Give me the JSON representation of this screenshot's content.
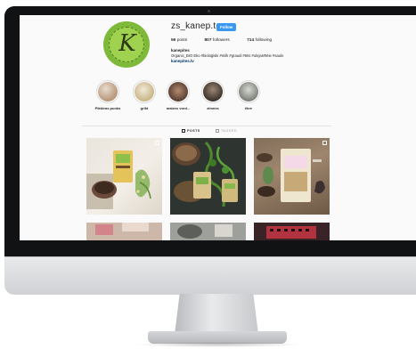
{
  "profile": {
    "username": "zs_kanep.tes",
    "follow_label": "Follow",
    "stats": [
      {
        "value": "56",
        "label": "posts"
      },
      {
        "value": "807",
        "label": "followers"
      },
      {
        "value": "714",
        "label": "following"
      }
    ],
    "display_name": "kanepites",
    "bio": "Organic_BIO Eko #bioloģiski #milk #graudi #tēis #ulejas#tēie #saule",
    "link": "kanepites.lv"
  },
  "highlights": [
    {
      "label": "Piktūras punks",
      "color": "#c9a98a"
    },
    {
      "label": "grīkt",
      "color": "#d7c7a3"
    },
    {
      "label": "maizes vord...",
      "color": "#8a6b5a"
    },
    {
      "label": "zimnes",
      "color": "#6d5a4c"
    },
    {
      "label": "ēkre",
      "color": "#a7aaa2"
    }
  ],
  "tabs": [
    {
      "label": "POSTS",
      "active": true
    },
    {
      "label": "TAGGED",
      "active": false
    }
  ],
  "colors": {
    "accent": "#3897f0",
    "link": "#003569",
    "avatar_green": "#7fb93a"
  }
}
